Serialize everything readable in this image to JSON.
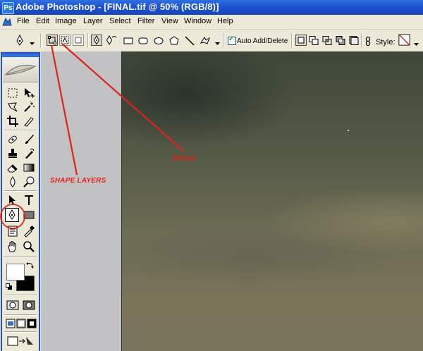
{
  "window": {
    "title": "Adobe Photoshop - [FINAL.tif @ 50% (RGB/8)]"
  },
  "menu": [
    "File",
    "Edit",
    "Image",
    "Layer",
    "Select",
    "Filter",
    "View",
    "Window",
    "Help"
  ],
  "options_bar": {
    "auto_add_delete_label": "Auto Add/Delete",
    "auto_add_delete_checked": true,
    "style_label": "Style:"
  },
  "annotations": {
    "shape_layers": "SHAPE LAYERS",
    "paths": "PATHS"
  },
  "icons": [
    "pen-tool-icon",
    "shape-layers-icon",
    "paths-icon",
    "fill-pixels-icon",
    "freeform-pen-icon",
    "rectangle-icon",
    "rounded-rectangle-icon",
    "ellipse-icon",
    "polygon-icon",
    "line-icon",
    "custom-shape-icon",
    "link-icon",
    "style-swatch-icon"
  ],
  "colors": {
    "annotation_red": "#e0221b",
    "title_blue": "#1c4fcf",
    "foreground": "#ffffff",
    "background": "#000000"
  }
}
